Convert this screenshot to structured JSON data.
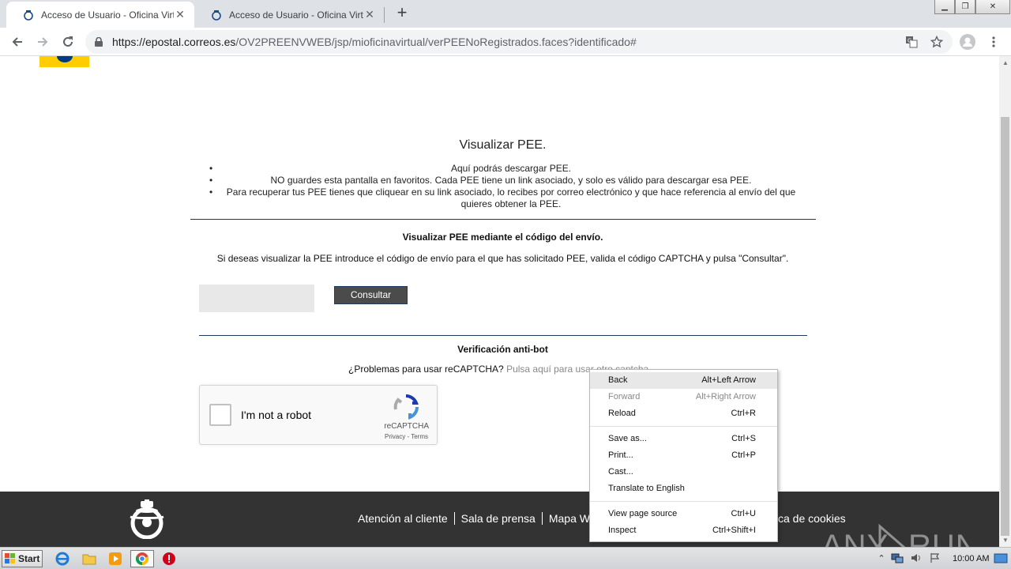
{
  "browser": {
    "tabs": [
      {
        "title": "Acceso de Usuario - Oficina Virtual",
        "active": true
      },
      {
        "title": "Acceso de Usuario - Oficina Virtual",
        "active": false
      }
    ],
    "new_tab": "+",
    "url_host": "https://epostal.correos.es",
    "url_path": "/OV2PREENVWEB/jsp/mioficinavirtual/verPEENoRegistrados.faces?identificado#"
  },
  "page": {
    "title": "Visualizar PEE.",
    "bullets": [
      "Aquí podrás descargar PEE.",
      "NO guardes esta pantalla en favoritos. Cada PEE tiene un link asociado, y solo es válido para descargar esa PEE.",
      "Para recuperar tus PEE tienes que cliquear en su link asociado, lo recibes por correo electrónico y que hace referencia al envío del que quieres obtener la PEE."
    ],
    "code_section": {
      "heading": "Visualizar PEE mediante el código del envío.",
      "description": "Si deseas visualizar la PEE introduce el código de envío para el que has solicitado PEE, valida el código CAPTCHA y pulsa \"Consultar\".",
      "input_value": "",
      "button_label": "Consultar"
    },
    "antibot": {
      "heading": "Verificación anti-bot",
      "question": "¿Problemas para usar reCAPTCHA?",
      "link": "Pulsa aquí para usar otro captcha"
    },
    "recaptcha": {
      "label": "I'm not a robot",
      "brand": "reCAPTCHA",
      "terms": "Privacy - Terms"
    },
    "footer": {
      "links": [
        "Atención al cliente",
        "Sala de prensa",
        "Mapa W"
      ],
      "tail": "ca de cookies",
      "watermark": "ANY RUN"
    }
  },
  "context_menu": {
    "items": [
      {
        "label": "Back",
        "shortcut": "Alt+Left Arrow"
      },
      {
        "label": "Forward",
        "shortcut": "Alt+Right Arrow"
      },
      {
        "label": "Reload",
        "shortcut": "Ctrl+R"
      },
      {
        "label": "Save as...",
        "shortcut": "Ctrl+S"
      },
      {
        "label": "Print...",
        "shortcut": "Ctrl+P"
      },
      {
        "label": "Cast...",
        "shortcut": ""
      },
      {
        "label": "Translate to English",
        "shortcut": ""
      },
      {
        "label": "View page source",
        "shortcut": "Ctrl+U"
      },
      {
        "label": "Inspect",
        "shortcut": "Ctrl+Shift+I"
      }
    ]
  },
  "taskbar": {
    "start_label": "Start",
    "clock": "10:00 AM"
  },
  "colors": {
    "correos_yellow": "#ffcd00",
    "correos_blue": "#003c84",
    "footer_bg": "#333333",
    "button_bg": "#4b4b4b"
  }
}
